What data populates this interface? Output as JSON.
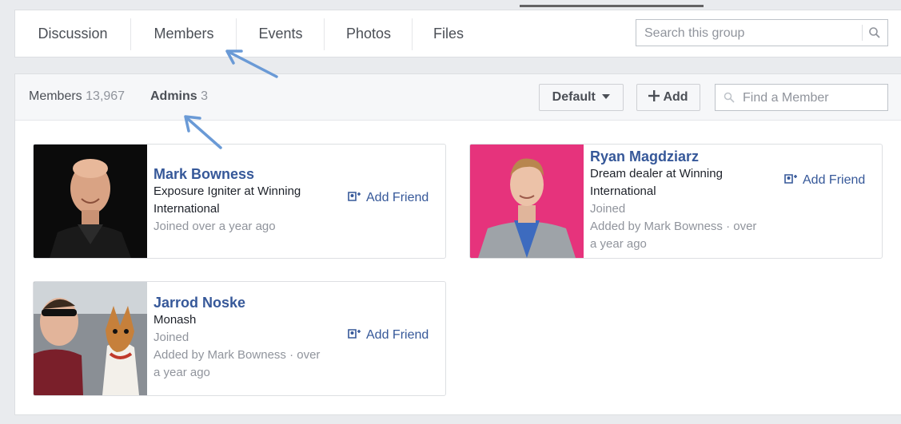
{
  "tabs": [
    {
      "label": "Discussion"
    },
    {
      "label": "Members"
    },
    {
      "label": "Events"
    },
    {
      "label": "Photos"
    },
    {
      "label": "Files"
    }
  ],
  "search": {
    "placeholder": "Search this group",
    "icon": "search-icon"
  },
  "members_panel": {
    "filters": {
      "members": {
        "label": "Members",
        "count": "13,967"
      },
      "admins": {
        "label": "Admins",
        "count": "3"
      }
    },
    "sort_button": {
      "label": "Default",
      "icon": "caret-down-icon"
    },
    "add_button": {
      "label": "Add",
      "icon": "plus-icon"
    },
    "find": {
      "placeholder": "Find a Member",
      "icon": "search-icon"
    }
  },
  "cards": [
    {
      "name": "Mark Bowness",
      "line1": "Exposure Igniter at Winning",
      "line2": "International",
      "line3": "Joined over a year ago",
      "action": "Add Friend"
    },
    {
      "name": "Ryan Magdziarz",
      "line1": "Dream dealer at Winning",
      "line2": "International",
      "line3": "Joined",
      "line4": "Added by Mark Bowness · over",
      "line5": "a year ago",
      "action": "Add Friend"
    },
    {
      "name": "Jarrod Noske",
      "line1": "Monash",
      "line2": "Joined",
      "line3": "Added by Mark Bowness · over",
      "line4": "a year ago",
      "action": "Add Friend"
    }
  ],
  "colors": {
    "link": "#365899",
    "annotation_arrow": "#6a9ad6",
    "background": "#e9ebee"
  }
}
